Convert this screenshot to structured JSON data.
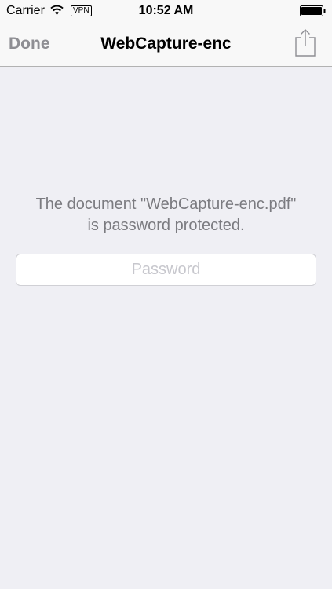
{
  "status_bar": {
    "carrier": "Carrier",
    "wifi_icon": "wifi-icon",
    "vpn_label": "VPN",
    "time": "10:52 AM",
    "battery_icon": "battery-full-icon"
  },
  "nav_bar": {
    "done_label": "Done",
    "title": "WebCapture-enc",
    "share_icon": "share-icon"
  },
  "content": {
    "message_line1": "The document \"WebCapture-enc.pdf\"",
    "message_line2": "is password protected.",
    "password_placeholder": "Password",
    "password_value": ""
  },
  "colors": {
    "background": "#efeff4",
    "bar_background": "#f8f8f8",
    "disabled_button": "#8e8e93",
    "message_text": "#7b7b80"
  }
}
